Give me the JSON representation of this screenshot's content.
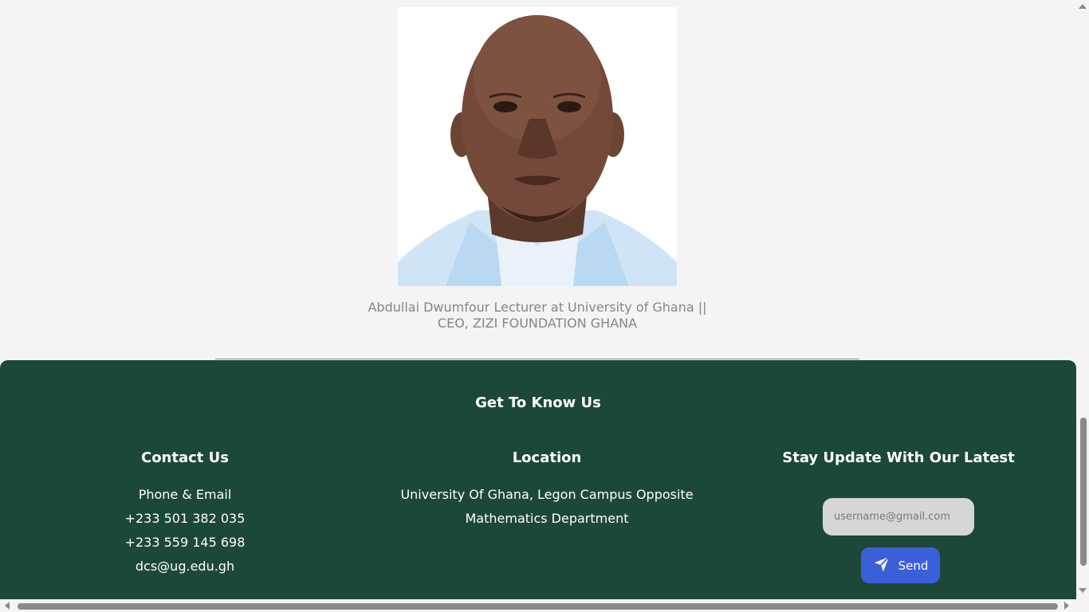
{
  "profile": {
    "photo_icon": "portrait-photo",
    "caption_line1": "Abdullai Dwumfour Lecturer at University of Ghana ||",
    "caption_line2": "CEO, ZIZI FOUNDATION GHANA"
  },
  "footer": {
    "title": "Get To Know Us",
    "background_color": "#1c4838",
    "contact": {
      "heading": "Contact Us",
      "lines": [
        "Phone & Email",
        "+233 501 382 035",
        "+233 559 145 698",
        "dcs@ug.edu.gh"
      ]
    },
    "location": {
      "heading": "Location",
      "lines": [
        "University Of Ghana, Legon Campus Opposite",
        "Mathematics Department"
      ]
    },
    "subscribe": {
      "heading": "Stay Update With Our Latest",
      "email_placeholder": "username@gmail.com",
      "send_label": "Send",
      "send_icon": "paper-plane-icon",
      "button_color": "#3b5fd9"
    }
  }
}
